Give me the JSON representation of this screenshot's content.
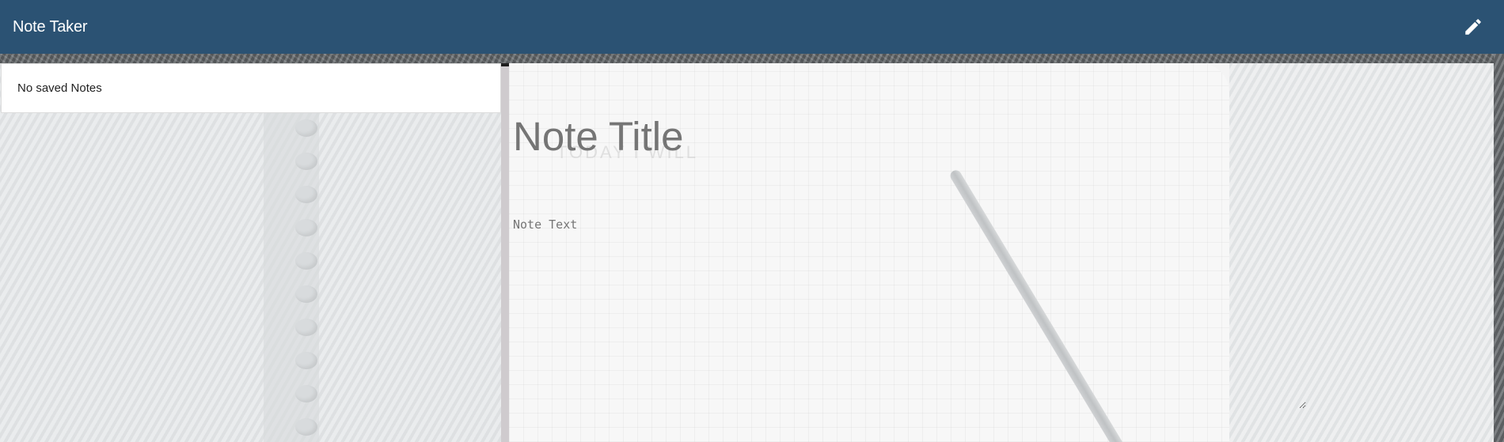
{
  "navbar": {
    "brand": "Note Taker",
    "new_note_icon": "pencil-icon"
  },
  "sidebar": {
    "empty_message": "No saved Notes"
  },
  "editor": {
    "title_placeholder": "Note Title",
    "text_placeholder": "Note Text"
  },
  "background": {
    "ghost_text": "TODAY I WILL"
  },
  "colors": {
    "navbar": "#2b5273",
    "text": "#222222",
    "placeholder": "#6b6b6b"
  }
}
